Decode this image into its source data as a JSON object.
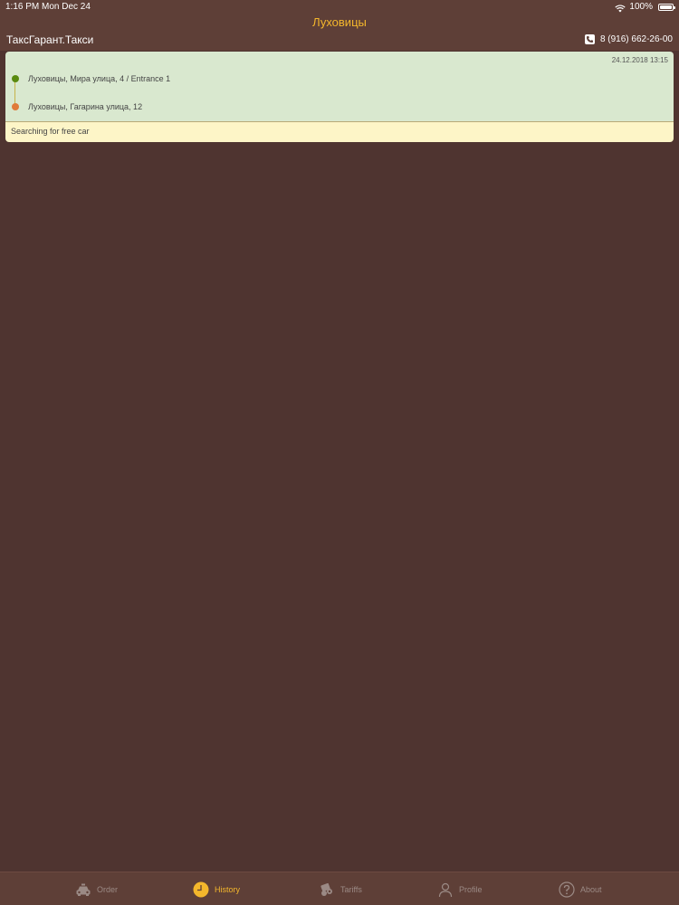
{
  "status_bar": {
    "time": "1:16 PM",
    "date": "Mon Dec 24",
    "battery": "100%"
  },
  "header": {
    "title": "Луховицы",
    "app_name": "ТаксГарант.Такси",
    "phone": "8 (916) 662-26-00"
  },
  "order": {
    "date": "24.12.2018 13:15",
    "from": "Луховицы, Мира улица, 4 / Entrance 1",
    "to": "Луховицы, Гагарина улица, 12",
    "status": "Searching for free car"
  },
  "tabs": [
    {
      "label": "Order",
      "icon": "taxi-car-icon",
      "active": false
    },
    {
      "label": "History",
      "icon": "clock-icon",
      "active": true
    },
    {
      "label": "Tariffs",
      "icon": "money-icon",
      "active": false
    },
    {
      "label": "Profile",
      "icon": "person-icon",
      "active": false
    },
    {
      "label": "About",
      "icon": "question-icon",
      "active": false
    }
  ],
  "colors": {
    "background": "#4f3430",
    "accent": "#f4b72c",
    "route_bg": "#d9e8cf",
    "status_bg": "#fdf5c7",
    "from_dot": "#5a8a10",
    "to_dot": "#e07a3a"
  }
}
